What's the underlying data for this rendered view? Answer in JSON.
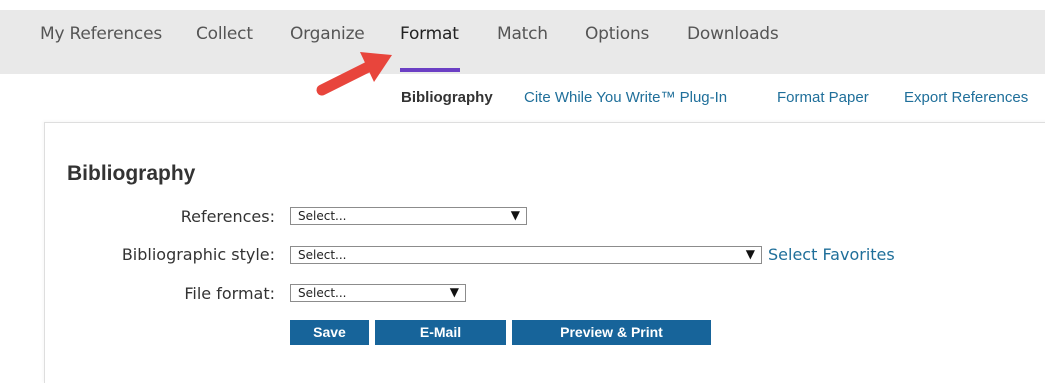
{
  "topnav": {
    "tabs": [
      {
        "label": "My References"
      },
      {
        "label": "Collect"
      },
      {
        "label": "Organize"
      },
      {
        "label": "Format"
      },
      {
        "label": "Match"
      },
      {
        "label": "Options"
      },
      {
        "label": "Downloads"
      }
    ],
    "active_tab": "Format",
    "accent_color": "#6b3fc4"
  },
  "subnav": {
    "links": [
      {
        "label": "Bibliography"
      },
      {
        "label": "Cite While You Write™ Plug-In"
      },
      {
        "label": "Format Paper"
      },
      {
        "label": "Export References"
      }
    ],
    "current": "Bibliography"
  },
  "annotation": {
    "icon": "red-arrow-icon",
    "color": "#e8453c"
  },
  "form": {
    "title": "Bibliography",
    "references": {
      "label": "References:",
      "value": "Select..."
    },
    "style": {
      "label": "Bibliographic style:",
      "value": "Select..."
    },
    "file_format": {
      "label": "File format:",
      "value": "Select..."
    },
    "select_favorites": "Select Favorites",
    "buttons": {
      "save": "Save",
      "email": "E-Mail",
      "preview": "Preview & Print"
    },
    "button_color": "#17649a"
  }
}
